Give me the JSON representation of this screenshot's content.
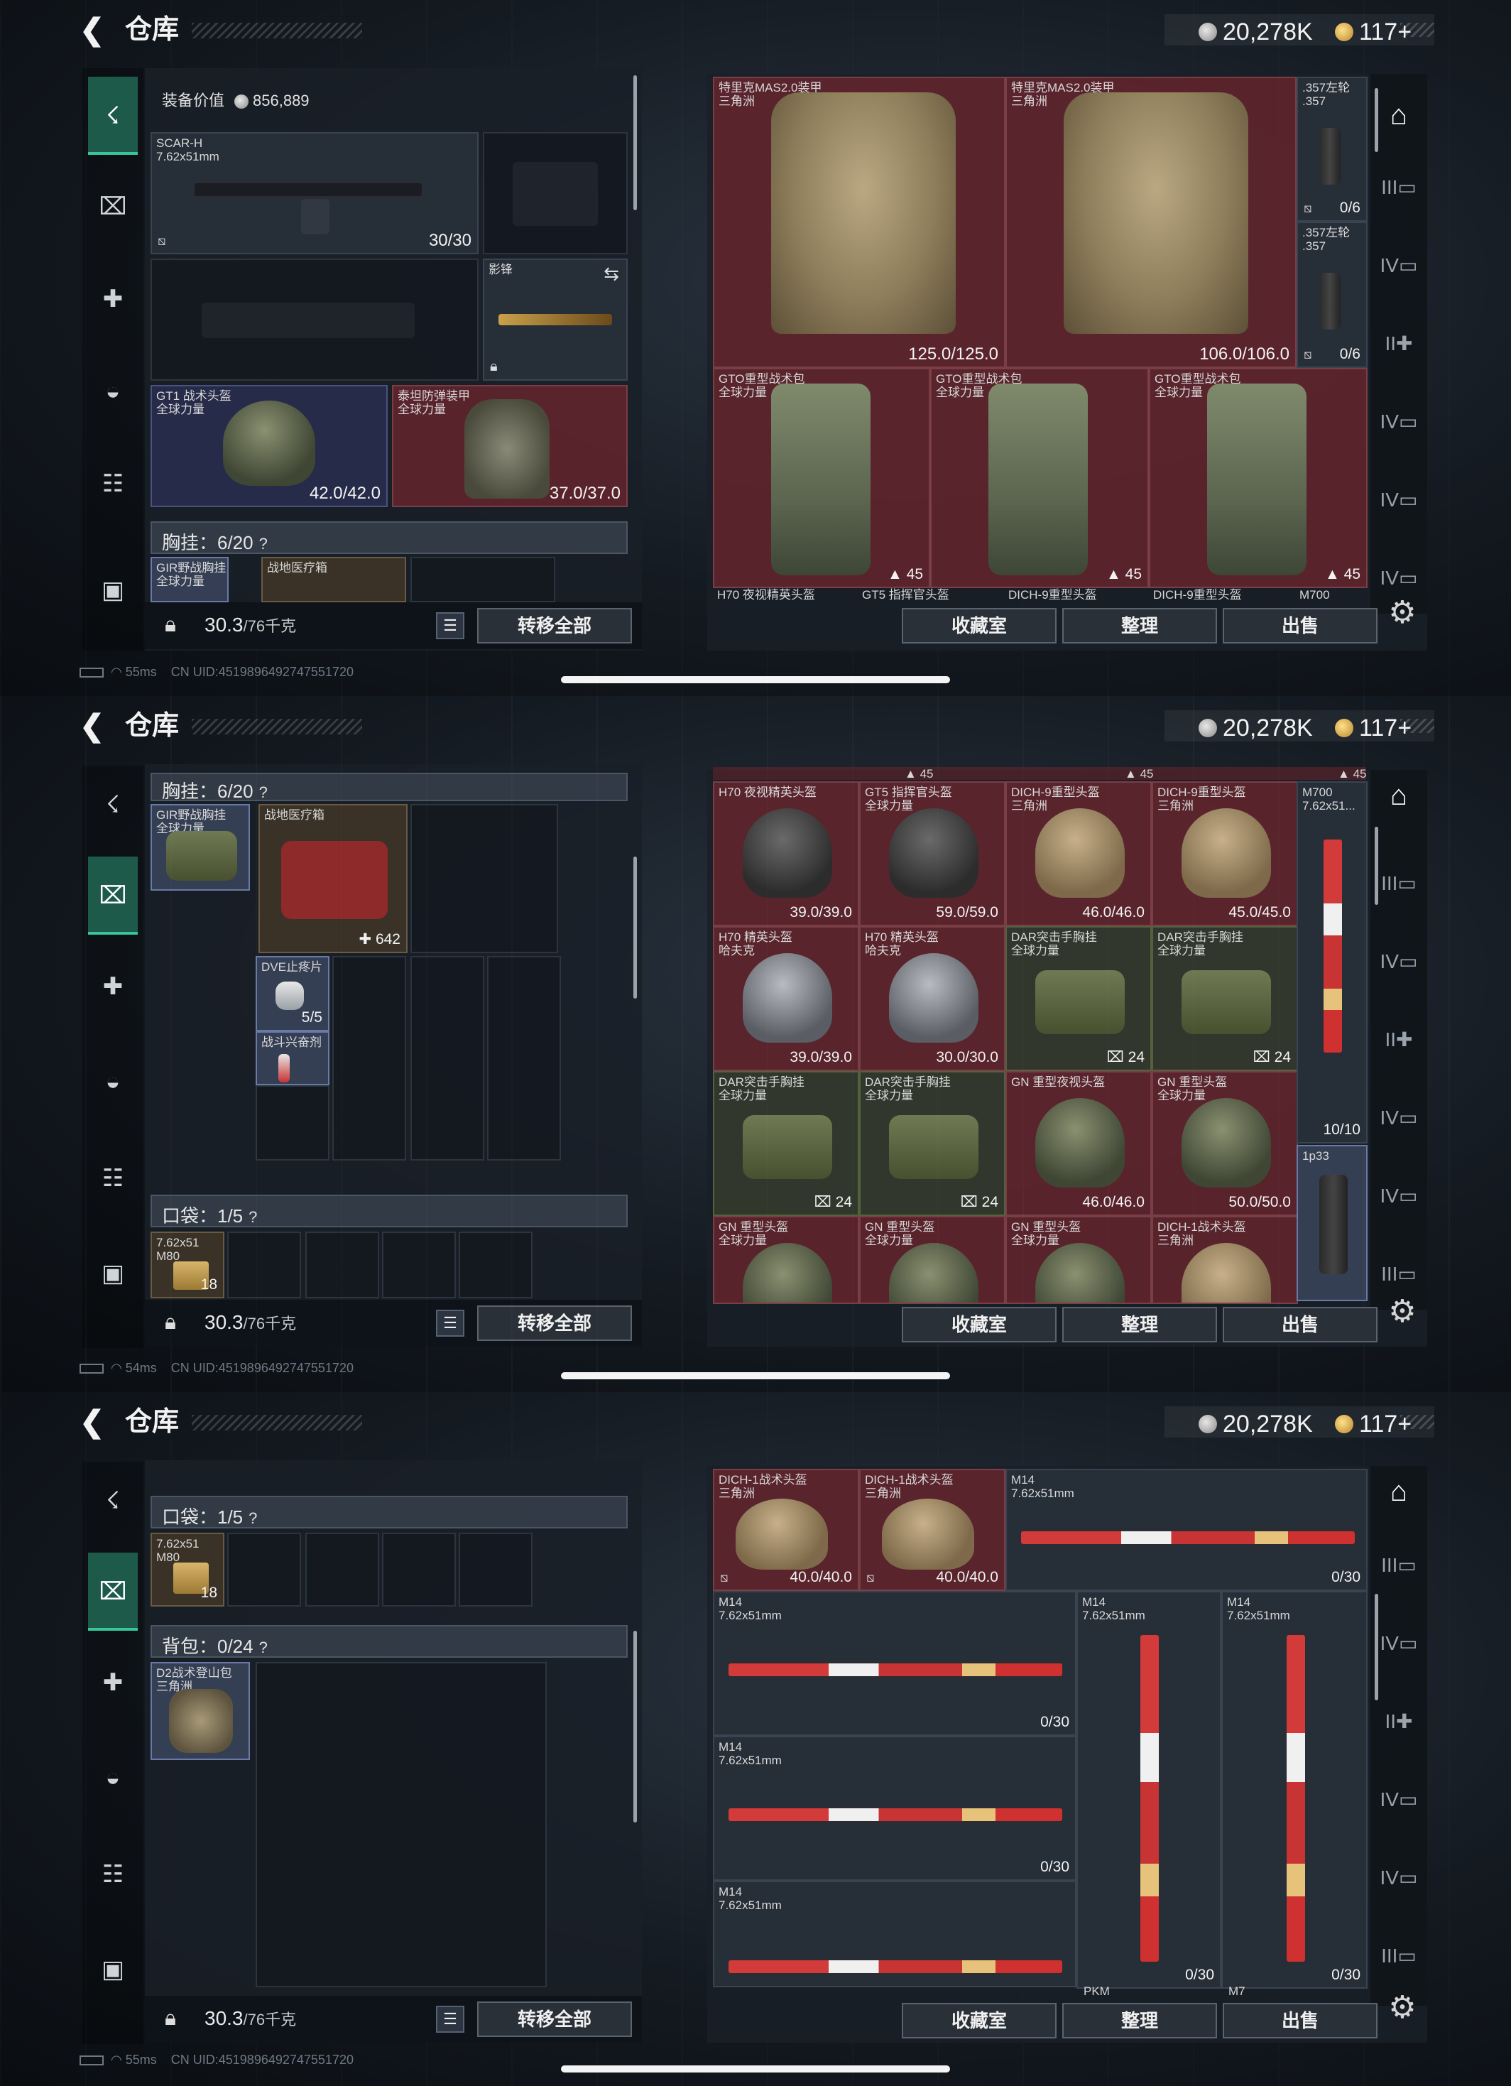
{
  "header": {
    "title": "仓库",
    "silver": "20,278K",
    "gold": "117+"
  },
  "bottom": {
    "weight_used": "30.3",
    "weight_cap": "/76千克",
    "transfer_all": "转移全部"
  },
  "right_buttons": {
    "collection": "收藏室",
    "sort": "整理",
    "sell": "出售"
  },
  "status": [
    "55ms",
    "54ms",
    "55ms"
  ],
  "uid": "CN UID:4519896492747551720",
  "icons": {
    "back": "back-arrow-icon",
    "settings": "gear-icon",
    "lock": "lock-icon"
  },
  "colors": {
    "accent": "#37c59a",
    "red_bg": "#62242c",
    "panel": "#1a2028"
  },
  "screen1": {
    "equip_value_label": "装备价值",
    "equip_value": "856,889",
    "primary": {
      "name": "SCAR-H",
      "sub": "7.62x51mm",
      "ammo": "30/30"
    },
    "melee": {
      "name": "影锋"
    },
    "helmet": {
      "name": "GT1 战术头盔",
      "sub": "全球力量",
      "dur": "42.0/42.0"
    },
    "armor": {
      "name": "泰坦防弹装甲",
      "sub": "全球力量",
      "dur": "37.0/37.0"
    },
    "rig_header": "胸挂：6/20",
    "rig_preview": [
      {
        "name": "GIR野战胸挂",
        "sub": "全球力量"
      },
      {
        "name": "战地医疗箱"
      }
    ],
    "stash": [
      {
        "name": "特里克MAS2.0装甲",
        "sub": "三角洲",
        "dur": "125.0/125.0"
      },
      {
        "name": "特里克MAS2.0装甲",
        "sub": "三角洲",
        "dur": "106.0/106.0"
      },
      {
        "name": ".357左轮",
        "sub": ".357",
        "ammo": "0/6"
      },
      {
        "name": ".357左轮",
        "sub": ".357",
        "ammo": "0/6"
      },
      {
        "name": "GTO重型战术包",
        "sub": "全球力量",
        "count": "45"
      },
      {
        "name": "GTO重型战术包",
        "sub": "全球力量",
        "count": "45"
      },
      {
        "name": "GTO重型战术包",
        "sub": "全球力量",
        "count": "45"
      }
    ],
    "cut_labels": [
      "H70 夜视精英头盔",
      "GT5 指挥官头盔",
      "DICH-9重型头盔",
      "DICH-9重型头盔",
      "M700"
    ]
  },
  "screen2": {
    "rig_header": "胸挂：6/20",
    "rig": {
      "name": "GIR野战胸挂",
      "sub": "全球力量"
    },
    "medkit": {
      "name": "战地医疗箱",
      "count": "642"
    },
    "pill": {
      "name": "DVE止疼片",
      "count": "5/5"
    },
    "stim": {
      "name": "战斗兴奋剂"
    },
    "pocket_header": "口袋：1/5",
    "ammo": {
      "name": "7.62x51",
      "sub": "M80",
      "count": "18"
    },
    "top_counts": [
      "45",
      "45",
      "45"
    ],
    "stash": [
      {
        "name": "H70 夜视精英头盔",
        "sub": "",
        "dur": "39.0/39.0"
      },
      {
        "name": "GT5 指挥官头盔",
        "sub": "全球力量",
        "dur": "59.0/59.0"
      },
      {
        "name": "DICH-9重型头盔",
        "sub": "三角洲",
        "dur": "46.0/46.0"
      },
      {
        "name": "DICH-9重型头盔",
        "sub": "三角洲",
        "dur": "45.0/45.0"
      },
      {
        "name": "H70 精英头盔",
        "sub": "哈夫克",
        "dur": "39.0/39.0"
      },
      {
        "name": "H70 精英头盔",
        "sub": "哈夫克",
        "dur": "30.0/30.0"
      },
      {
        "name": "DAR突击手胸挂",
        "sub": "全球力量",
        "count": "24"
      },
      {
        "name": "DAR突击手胸挂",
        "sub": "全球力量",
        "count": "24"
      },
      {
        "name": "DAR突击手胸挂",
        "sub": "全球力量",
        "count": "24"
      },
      {
        "name": "DAR突击手胸挂",
        "sub": "全球力量",
        "count": "24"
      },
      {
        "name": "GN 重型夜视头盔",
        "sub": "",
        "dur": "46.0/46.0"
      },
      {
        "name": "GN 重型头盔",
        "sub": "全球力量",
        "dur": "50.0/50.0"
      },
      {
        "name": "GN 重型头盔",
        "sub": "全球力量"
      },
      {
        "name": "GN 重型头盔",
        "sub": "全球力量"
      },
      {
        "name": "GN 重型头盔",
        "sub": "全球力量"
      },
      {
        "name": "DICH-1战术头盔",
        "sub": "三角洲"
      }
    ],
    "m700": {
      "name": "M700",
      "sub": "7.62x51...",
      "ammo": "10/10"
    },
    "scope": {
      "name": "1p33"
    }
  },
  "screen3": {
    "pocket_header": "口袋：1/5",
    "ammo": {
      "name": "7.62x51",
      "sub": "M80",
      "count": "18"
    },
    "backpack_header": "背包：0/24",
    "backpack": {
      "name": "D2战术登山包",
      "sub": "三角洲"
    },
    "stash": [
      {
        "name": "DICH-1战术头盔",
        "sub": "三角洲",
        "dur": "40.0/40.0"
      },
      {
        "name": "DICH-1战术头盔",
        "sub": "三角洲",
        "dur": "40.0/40.0"
      },
      {
        "name": "M14",
        "sub": "7.62x51mm",
        "ammo": "0/30"
      },
      {
        "name": "M14",
        "sub": "7.62x51mm",
        "ammo": "0/30"
      },
      {
        "name": "M14",
        "sub": "7.62x51mm",
        "ammo": "0/30"
      },
      {
        "name": "M14",
        "sub": "7.62x51mm",
        "ammo": "0/30"
      },
      {
        "name": "M14",
        "sub": "7.62x51mm",
        "ammo": "0/30"
      },
      {
        "name": "M14",
        "sub": "7.62x51mm"
      }
    ],
    "cut_labels": [
      "PKM",
      "M7"
    ]
  }
}
